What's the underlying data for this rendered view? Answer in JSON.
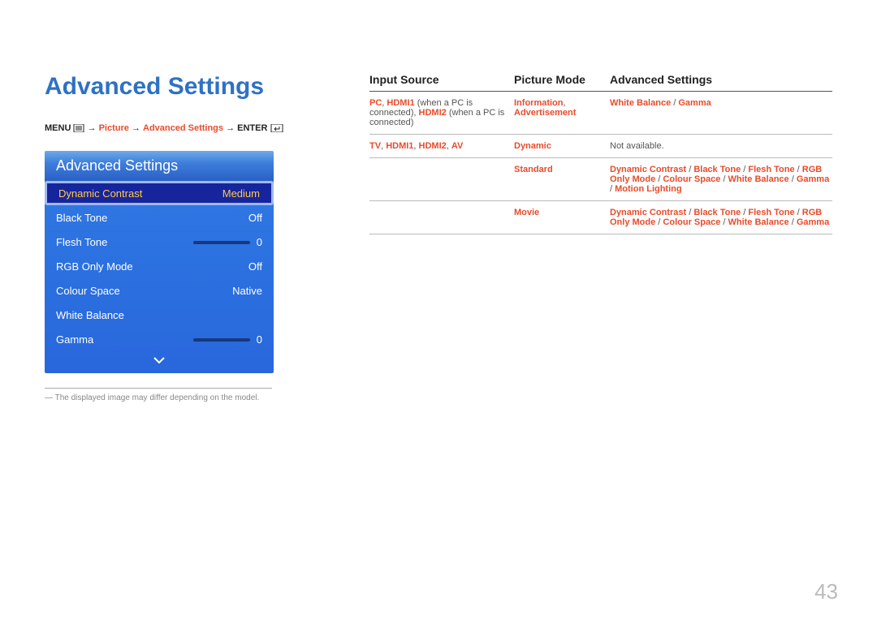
{
  "page_number": "43",
  "title": "Advanced Settings",
  "breadcrumb": {
    "menu": "MENU",
    "arrow": "→",
    "picture": "Picture",
    "advanced": "Advanced Settings",
    "enter": "ENTER"
  },
  "panel": {
    "header": "Advanced Settings",
    "items": [
      {
        "label": "Dynamic Contrast",
        "value": "Medium",
        "selected": true
      },
      {
        "label": "Black Tone",
        "value": "Off"
      },
      {
        "label": "Flesh Tone",
        "value": "0",
        "slider": true
      },
      {
        "label": "RGB Only Mode",
        "value": "Off"
      },
      {
        "label": "Colour Space",
        "value": "Native"
      },
      {
        "label": "White Balance",
        "value": ""
      },
      {
        "label": "Gamma",
        "value": "0",
        "slider": true
      }
    ]
  },
  "footnote": "The displayed image may differ depending on the model.",
  "table": {
    "headers": [
      "Input Source",
      "Picture Mode",
      "Advanced Settings"
    ],
    "rows": {
      "r1": {
        "col1_parts": [
          "PC",
          ", ",
          "HDMI1",
          " (when a PC is connected), ",
          "HDMI2",
          " (when a PC is connected)"
        ],
        "col2_parts": [
          "Information",
          ", ",
          "Advertisement"
        ],
        "col3_parts": [
          "White Balance",
          " / ",
          "Gamma"
        ]
      },
      "r2": {
        "col1_parts": [
          "TV",
          ", ",
          "HDMI1",
          ", ",
          "HDMI2",
          ", ",
          "AV"
        ],
        "col2": "Dynamic",
        "col3_plain": "Not available."
      },
      "r3": {
        "col2": "Standard",
        "col3_parts": [
          "Dynamic Contrast",
          " / ",
          "Black Tone",
          " / ",
          "Flesh Tone",
          " / ",
          "RGB Only Mode",
          " / ",
          "Colour Space",
          " / ",
          "White Balance",
          " / ",
          "Gamma",
          " / ",
          "Motion Lighting"
        ]
      },
      "r4": {
        "col2": "Movie",
        "col3_parts": [
          "Dynamic Contrast",
          " / ",
          "Black Tone",
          " / ",
          "Flesh Tone",
          " / ",
          "RGB Only Mode",
          " / ",
          "Colour Space",
          " / ",
          "White Balance",
          " / ",
          "Gamma"
        ]
      }
    }
  }
}
